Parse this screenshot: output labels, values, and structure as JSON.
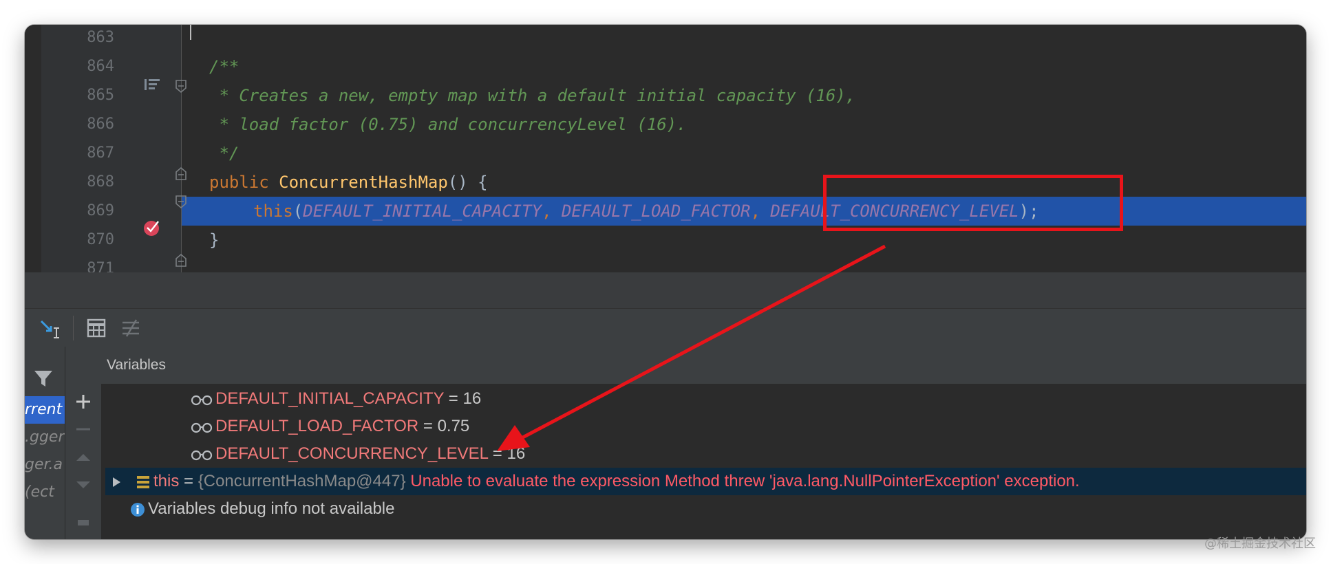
{
  "editor": {
    "lines": [
      {
        "num": "863",
        "code": ""
      },
      {
        "num": "864",
        "code": "/**"
      },
      {
        "num": "865",
        "code": " * Creates a new, empty map with a default initial capacity (16),"
      },
      {
        "num": "866",
        "code": " * load factor (0.75) and concurrencyLevel (16)."
      },
      {
        "num": "867",
        "code": " */"
      },
      {
        "num": "868",
        "kw": "public ",
        "fn": "ConcurrentHashMap",
        "rest": "() {"
      },
      {
        "num": "869",
        "kw": "this",
        "open": "(",
        "a1": "DEFAULT_INITIAL_CAPACITY",
        "c1": ", ",
        "a2": "DEFAULT_LOAD_FACTOR",
        "c2": ", ",
        "a3": "DEFAULT_CONCURRENCY_LEVEL",
        "close": ");"
      },
      {
        "num": "870",
        "code": "}"
      },
      {
        "num": "871",
        "code": ""
      }
    ]
  },
  "debugger": {
    "variables_title": "Variables",
    "frames": [
      "rrent",
      "gger.",
      "ger.a",
      "ect)"
    ],
    "variables": [
      {
        "name": "DEFAULT_INITIAL_CAPACITY",
        "eq": " = ",
        "value": "16"
      },
      {
        "name": "DEFAULT_LOAD_FACTOR",
        "eq": " = ",
        "value": "0.75"
      },
      {
        "name": "DEFAULT_CONCURRENCY_LEVEL",
        "eq": " = ",
        "value": "16"
      }
    ],
    "this_row": {
      "name": "this",
      "eq": " = ",
      "ref": "{ConcurrentHashMap@447}",
      "error": "Unable to evaluate the expression Method threw 'java.lang.NullPointerException' exception."
    },
    "info_row": "Variables debug info not available"
  },
  "icons": {
    "gutter_bookmark": "method-list-icon",
    "breakpoint": "breakpoint-icon",
    "variable": "watch-glasses-icon",
    "object": "object-fields-icon",
    "info": "info-icon",
    "filter": "filter-icon",
    "add": "add-icon"
  },
  "colors": {
    "highlight": "#2153a8",
    "annotation_red": "#e8141a",
    "var_name": "#f27a7a",
    "error": "#ff5a66"
  },
  "watermark": "@稀土掘金技术社区"
}
